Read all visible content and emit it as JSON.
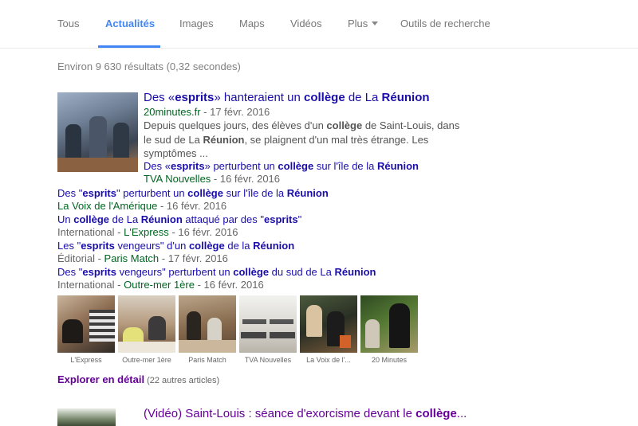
{
  "tabs": [
    {
      "label": "Tous"
    },
    {
      "label": "Actualités"
    },
    {
      "label": "Images"
    },
    {
      "label": "Maps"
    },
    {
      "label": "Vidéos"
    },
    {
      "label": "Plus"
    },
    {
      "label": "Outils de recherche"
    }
  ],
  "stats": "Environ 9 630 résultats (0,32 secondes)",
  "main_result": {
    "title": {
      "a": "Des «",
      "b": "esprits",
      "c": "» hanteraient un ",
      "d": "collège",
      "e": " de La ",
      "f": "Réunion"
    },
    "source": "20minutes.fr",
    "date": " - 17 févr. 2016",
    "snippet_lines": [
      {
        "a": "Depuis quelques jours, des élèves d'un ",
        "b": "collège",
        "c": " de Saint-Louis, dans"
      },
      {
        "a": "le sud de La ",
        "b": "Réunion",
        "c": ", se plaignent d'un mal très étrange. Les"
      },
      {
        "a": "symptômes ...",
        "b": "",
        "c": ""
      }
    ]
  },
  "related": [
    {
      "title": {
        "a": "Des «",
        "b": "esprits",
        "c": "» perturbent un ",
        "d": "collège",
        "e": " sur l'île de la ",
        "f": "Réunion"
      },
      "prefix": "",
      "source": "TVA Nouvelles",
      "date": " - 16 févr. 2016"
    },
    {
      "title": {
        "a": "Des \"",
        "b": "esprits",
        "c": "\" perturbent un ",
        "d": "collège",
        "e": " sur l'île de la ",
        "f": "Réunion"
      },
      "prefix": "",
      "source": "La Voix de l'Amérique",
      "date": " - 16 févr. 2016"
    },
    {
      "title": {
        "a": "Un ",
        "b": "collège",
        "c": " de La ",
        "d": "Réunion",
        "e": " attaqué par des \"",
        "f": "esprits",
        "g": "\""
      },
      "prefix": "International - ",
      "source": "L'Express",
      "date": " - 16 févr. 2016"
    },
    {
      "title": {
        "a": "Les \"",
        "b": "esprits",
        "c": " vengeurs\" d'un ",
        "d": "collège",
        "e": " de la ",
        "f": "Réunion"
      },
      "prefix": "Éditorial - ",
      "source": "Paris Match",
      "date": " - 17 févr. 2016"
    },
    {
      "title": {
        "a": "Des \"",
        "b": "esprits",
        "c": " vengeurs\" perturbent un ",
        "d": "collège",
        "e": " du sud de La ",
        "f": "Réunion"
      },
      "prefix": "International - ",
      "source": "Outre-mer 1ère",
      "date": " - 16 févr. 2016"
    }
  ],
  "thumbnails": [
    {
      "caption": "L'Express"
    },
    {
      "caption": "Outre-mer 1ère"
    },
    {
      "caption": "Paris Match"
    },
    {
      "caption": "TVA Nouvelles"
    },
    {
      "caption": "La Voix de l'..."
    },
    {
      "caption": "20 Minutes"
    }
  ],
  "explore": {
    "label": "Explorer en détail",
    "count": "(22 autres articles)"
  },
  "next_result": {
    "title": {
      "a": "(Vidéo) Saint-Louis : séance d'exorcisme devant le ",
      "b": "collège",
      "c": "..."
    }
  },
  "colors": {
    "link": "#1a0dab",
    "visited": "#660099",
    "source_green": "#006621",
    "tab_active": "#4285f4"
  }
}
